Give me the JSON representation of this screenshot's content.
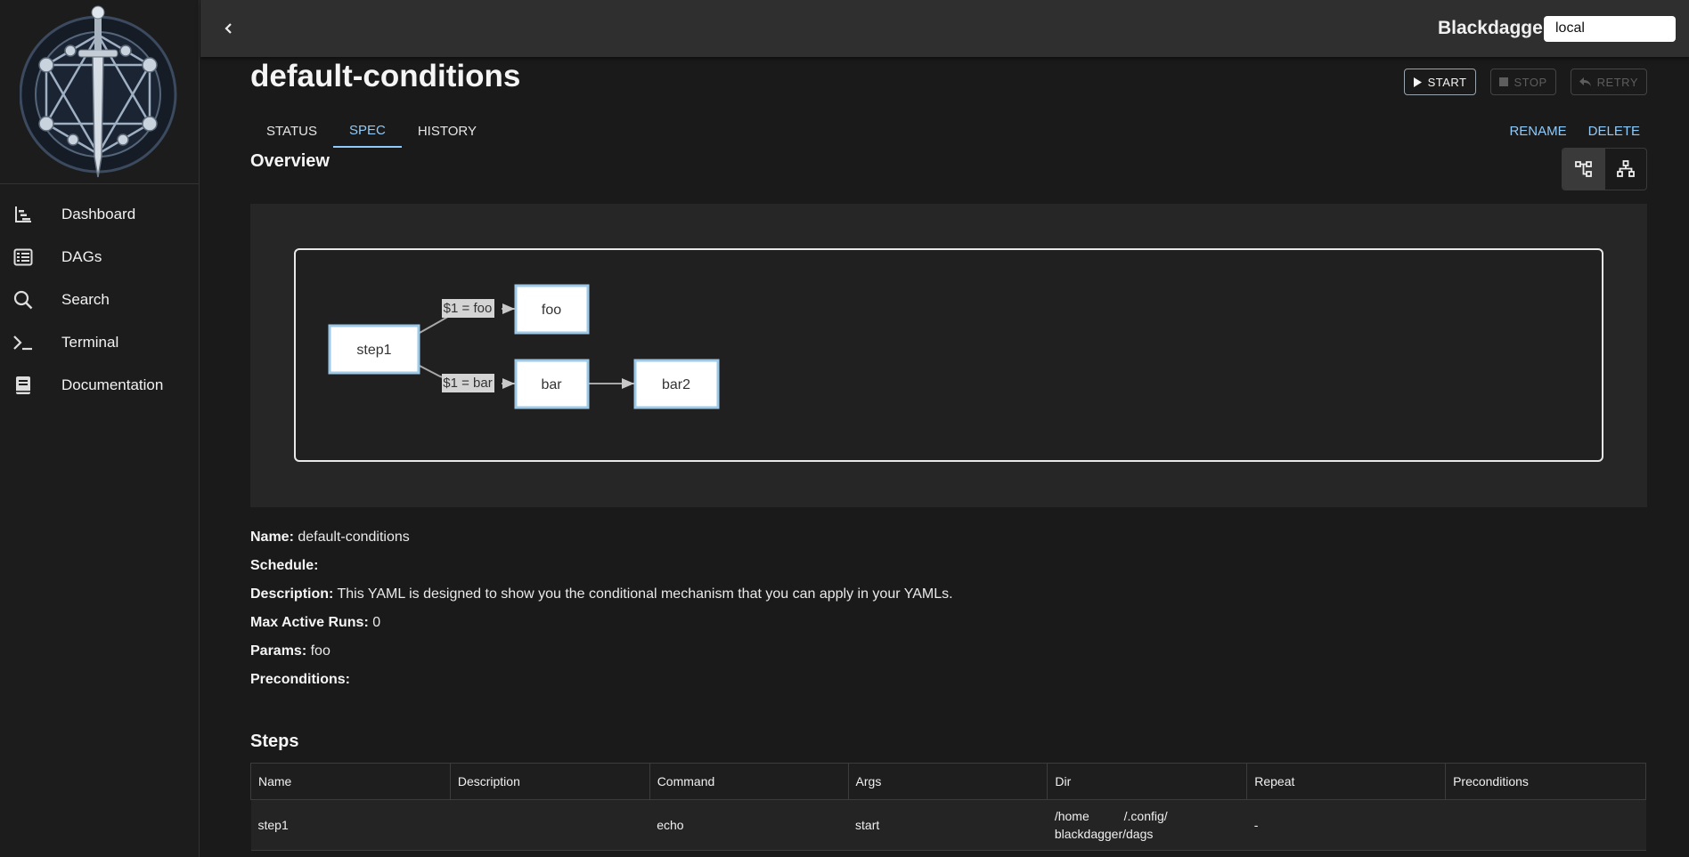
{
  "app": {
    "brand": "Blackdagger",
    "environment": "local"
  },
  "sidebar": {
    "items": [
      {
        "label": "Dashboard",
        "icon": "dashboard-chart-icon"
      },
      {
        "label": "DAGs",
        "icon": "list-icon"
      },
      {
        "label": "Search",
        "icon": "search-icon"
      },
      {
        "label": "Terminal",
        "icon": "terminal-icon"
      },
      {
        "label": "Documentation",
        "icon": "book-icon"
      }
    ]
  },
  "dag": {
    "title": "default-conditions",
    "actions": {
      "start": "START",
      "stop": "STOP",
      "retry": "RETRY"
    },
    "tabs": [
      "STATUS",
      "SPEC",
      "HISTORY"
    ],
    "active_tab": "SPEC",
    "links": {
      "rename": "RENAME",
      "delete": "DELETE"
    }
  },
  "overview": {
    "title": "Overview",
    "graph": {
      "nodes": [
        "step1",
        "foo",
        "bar",
        "bar2"
      ],
      "edges": [
        {
          "from": "step1",
          "to": "foo",
          "label": "$1 = foo"
        },
        {
          "from": "step1",
          "to": "bar",
          "label": "$1 = bar"
        },
        {
          "from": "bar",
          "to": "bar2",
          "label": ""
        }
      ]
    }
  },
  "info": {
    "name_label": "Name:",
    "name_value": "default-conditions",
    "schedule_label": "Schedule:",
    "schedule_value": "",
    "description_label": "Description:",
    "description_value": "This YAML is designed to show you the conditional mechanism that you can apply in your YAMLs.",
    "max_active_runs_label": "Max Active Runs:",
    "max_active_runs_value": "0",
    "params_label": "Params:",
    "params_value": "foo",
    "preconditions_label": "Preconditions:",
    "preconditions_value": ""
  },
  "steps": {
    "title": "Steps",
    "columns": [
      "Name",
      "Description",
      "Command",
      "Args",
      "Dir",
      "Repeat",
      "Preconditions"
    ],
    "rows": [
      {
        "name": "step1",
        "description": "",
        "command": "echo",
        "args": "start",
        "dir_line1": "/home          /.config/",
        "dir_line2": "blackdagger/dags",
        "repeat": "-",
        "preconditions": ""
      }
    ]
  }
}
